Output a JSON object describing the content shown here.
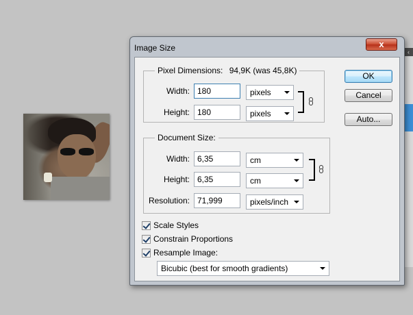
{
  "dialog": {
    "title": "Image Size",
    "close_label": "x"
  },
  "pixel_dimensions": {
    "label": "Pixel Dimensions:",
    "size_info": "94,9K (was 45,8K)",
    "width": {
      "label": "Width:",
      "value": "180",
      "unit": "pixels"
    },
    "height": {
      "label": "Height:",
      "value": "180",
      "unit": "pixels"
    }
  },
  "document_size": {
    "label": "Document Size:",
    "width": {
      "label": "Width:",
      "value": "6,35",
      "unit": "cm"
    },
    "height": {
      "label": "Height:",
      "value": "6,35",
      "unit": "cm"
    },
    "resolution": {
      "label": "Resolution:",
      "value": "71,999",
      "unit": "pixels/inch"
    }
  },
  "buttons": {
    "ok": "OK",
    "cancel": "Cancel",
    "auto": "Auto..."
  },
  "options": {
    "scale_styles": {
      "label": "Scale Styles",
      "checked": true
    },
    "constrain_proportions": {
      "label": "Constrain Proportions",
      "checked": true
    },
    "resample_image": {
      "label": "Resample Image:",
      "checked": true
    },
    "resample_method": "Bicubic (best for smooth gradients)"
  },
  "colors": {
    "background": "#c3c3c3",
    "dialog_frame": "#c0c6ce",
    "close_button": "#c9482d",
    "default_button_border": "#3c7fb1"
  },
  "icons": [
    "link-chain-icon",
    "close-icon",
    "checkmark-icon",
    "dropdown-arrow-icon"
  ]
}
